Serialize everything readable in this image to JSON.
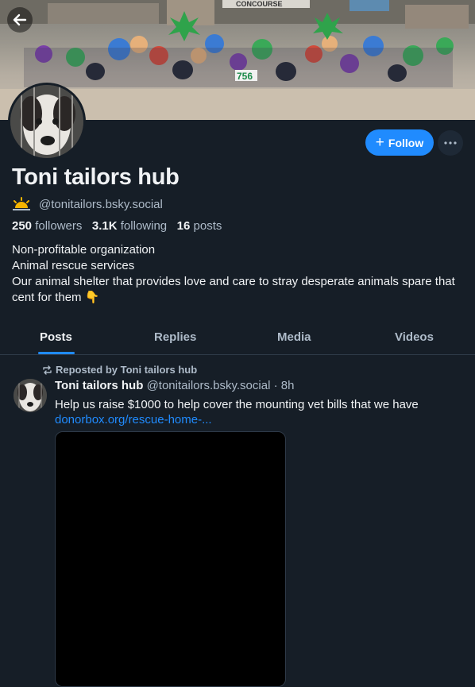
{
  "profile": {
    "display_name": "Toni tailors hub",
    "handle": "@tonitailors.bsky.social",
    "followers_count": "250",
    "followers_label": "followers",
    "following_count": "3.1K",
    "following_label": "following",
    "posts_count": "16",
    "posts_label": "posts",
    "bio_lines": [
      "Non-profitable organization",
      "Animal rescue services",
      "Our animal shelter that provides love and care to stray desperate animals spare that cent for them 👇"
    ]
  },
  "actions": {
    "follow_label": "Follow"
  },
  "banner": {
    "sign_text": "CONCOURSE",
    "number_sign": "756"
  },
  "tabs": [
    {
      "label": "Posts",
      "active": true
    },
    {
      "label": "Replies",
      "active": false
    },
    {
      "label": "Media",
      "active": false
    },
    {
      "label": "Videos",
      "active": false
    }
  ],
  "post": {
    "repost_label": "Reposted by Toni tailors hub",
    "author": "Toni tailors hub",
    "meta": "@tonitailors.bsky.social · 8h",
    "text": "Help us raise $1000 to help cover the mounting vet bills that we have",
    "link": "donorbox.org/rescue-home-..."
  },
  "colors": {
    "background": "#161e27",
    "accent": "#208bfe",
    "muted_text": "#aebbc9"
  }
}
